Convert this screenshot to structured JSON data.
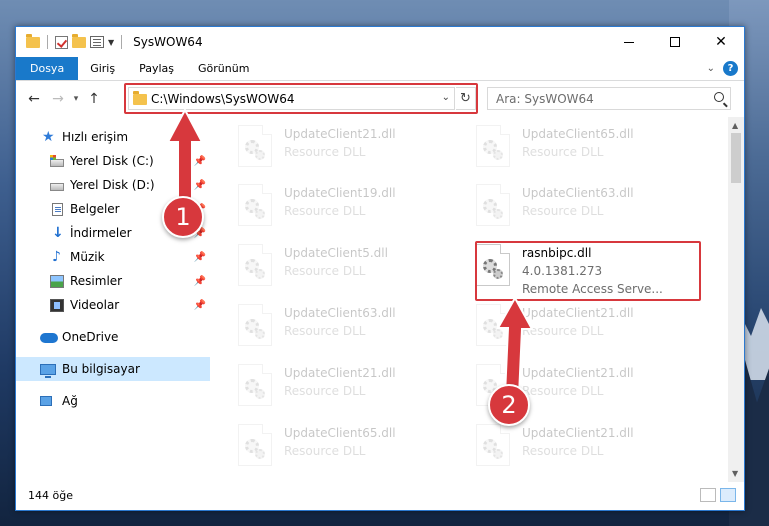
{
  "window": {
    "title": "SysWOW64",
    "controls": {
      "minimize": "—",
      "maximize": "☐",
      "close": "✕"
    }
  },
  "ribbon": {
    "tabs": [
      "Dosya",
      "Giriş",
      "Paylaş",
      "Görünüm"
    ],
    "help": "?"
  },
  "navigation": {
    "back": "←",
    "forward": "→",
    "recent": "▾",
    "up": "↑",
    "address": "C:\\Windows\\SysWOW64",
    "search_placeholder": "Ara: SysWOW64"
  },
  "sidebar": {
    "items": [
      {
        "label": "Hızlı erişim",
        "icon": "star-icon",
        "pinned": false
      },
      {
        "label": "Yerel Disk (C:)",
        "icon": "disk-icon",
        "pinned": true
      },
      {
        "label": "Yerel Disk (D:)",
        "icon": "disk-icon",
        "pinned": true
      },
      {
        "label": "Belgeler",
        "icon": "documents-icon",
        "pinned": true
      },
      {
        "label": "İndirmeler",
        "icon": "download-icon",
        "pinned": true
      },
      {
        "label": "Müzik",
        "icon": "music-icon",
        "pinned": true
      },
      {
        "label": "Resimler",
        "icon": "pictures-icon",
        "pinned": true
      },
      {
        "label": "Videolar",
        "icon": "videos-icon",
        "pinned": true
      },
      {
        "label": "OneDrive",
        "icon": "cloud-icon",
        "pinned": false
      },
      {
        "label": "Bu bilgisayar",
        "icon": "computer-icon",
        "pinned": false,
        "selected": true
      },
      {
        "label": "Ağ",
        "icon": "network-icon",
        "pinned": false
      }
    ],
    "pin_glyph": "📌"
  },
  "files": {
    "left_column": [
      {
        "name": "UpdateClient21.dll",
        "type": "Resource DLL"
      },
      {
        "name": "UpdateClient19.dll",
        "type": "Resource DLL"
      },
      {
        "name": "UpdateClient5.dll",
        "type": "Resource DLL"
      },
      {
        "name": "UpdateClient63.dll",
        "type": "Resource DLL"
      },
      {
        "name": "UpdateClient21.dll",
        "type": "Resource DLL"
      },
      {
        "name": "UpdateClient65.dll",
        "type": "Resource DLL"
      }
    ],
    "right_column": [
      {
        "name": "UpdateClient65.dll",
        "type": "Resource DLL"
      },
      {
        "name": "UpdateClient63.dll",
        "type": "Resource DLL"
      },
      {
        "name": "UpdateClient21.dll",
        "type": "Resource DLL"
      },
      {
        "name": "UpdateClient21.dll",
        "type": "Resource DLL"
      },
      {
        "name": "UpdateClient21.dll",
        "type": "Resource DLL"
      }
    ],
    "highlighted": {
      "name": "rasnbipc.dll",
      "version": "4.0.1381.273",
      "description": "Remote Access Serve..."
    }
  },
  "status": {
    "count": "144 öğe"
  },
  "annotations": {
    "badge1": "1",
    "badge2": "2",
    "color": "#d7383d"
  }
}
